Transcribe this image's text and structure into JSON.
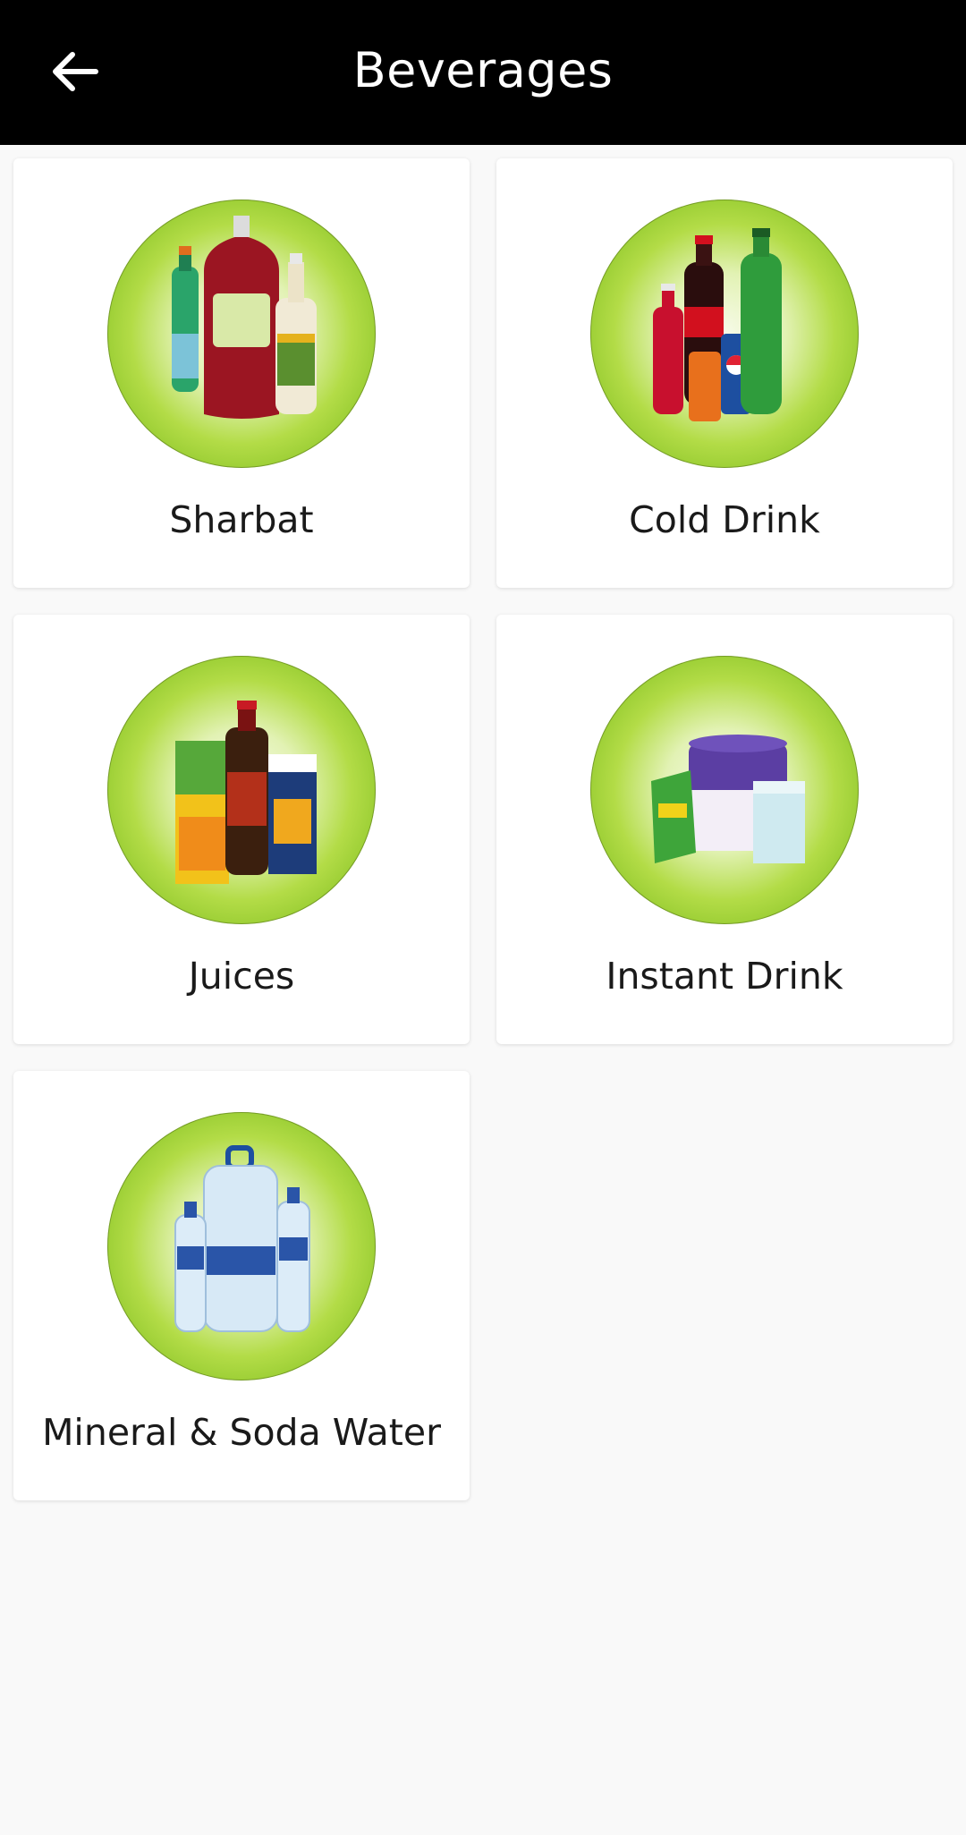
{
  "header": {
    "title": "Beverages",
    "back_icon": "arrow-left-icon"
  },
  "categories": [
    {
      "label": "Sharbat",
      "image": "sharbat-bottles-image"
    },
    {
      "label": "Cold Drink",
      "image": "cold-drink-bottles-image"
    },
    {
      "label": "Juices",
      "image": "juice-packs-image"
    },
    {
      "label": "Instant Drink",
      "image": "instant-drink-packs-image"
    },
    {
      "label": "Mineral & Soda Water",
      "image": "water-bottles-image"
    }
  ],
  "colors": {
    "app_bar": "#000000",
    "background": "#f9f9f9",
    "card": "#ffffff",
    "accent_green": "#8cc63f"
  }
}
